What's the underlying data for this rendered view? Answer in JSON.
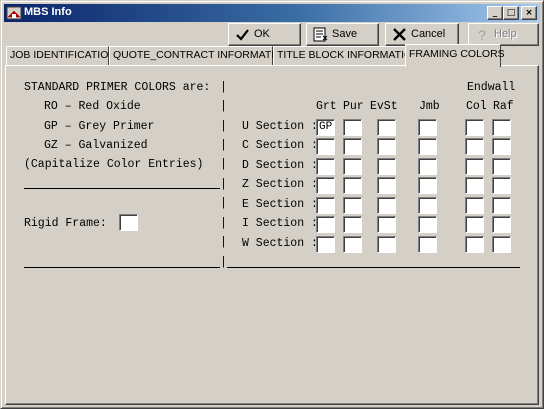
{
  "window": {
    "title": "MBS Info"
  },
  "titlebar_buttons": {
    "minimize": "_",
    "maximize": "□",
    "close": "×"
  },
  "toolbar": {
    "ok_label": "OK",
    "save_label": "Save",
    "cancel_label": "Cancel",
    "help_label": "Help"
  },
  "tabs": [
    {
      "label": "JOB IDENTIFICATION"
    },
    {
      "label": "QUOTE_CONTRACT INFORMATION"
    },
    {
      "label": "TITLE BLOCK INFORMATION"
    },
    {
      "label": "FRAMING COLORS"
    }
  ],
  "active_tab": "FRAMING COLORS",
  "left": {
    "heading": "STANDARD PRIMER COLORS are:",
    "codes": [
      {
        "code": "RO",
        "name": "Red Oxide"
      },
      {
        "code": "GP",
        "name": "Grey Primer"
      },
      {
        "code": "GZ",
        "name": "Galvanized"
      }
    ],
    "note": "(Capitalize Color Entries)",
    "rigid_frame_label": "Rigid Frame:",
    "rigid_frame_value": ""
  },
  "grid": {
    "group_header": "Endwall",
    "columns": [
      "Grt",
      "Pur",
      "EvSt",
      "Jmb",
      "Col",
      "Raf"
    ],
    "rows": [
      {
        "label": "U Section :",
        "values": [
          "GP",
          "",
          "",
          "",
          "",
          ""
        ]
      },
      {
        "label": "C Section :",
        "values": [
          "",
          "",
          "",
          "",
          "",
          ""
        ]
      },
      {
        "label": "D Section :",
        "values": [
          "",
          "",
          "",
          "",
          "",
          ""
        ]
      },
      {
        "label": "Z Section :",
        "values": [
          "",
          "",
          "",
          "",
          "",
          ""
        ]
      },
      {
        "label": "E Section :",
        "values": [
          "",
          "",
          "",
          "",
          "",
          ""
        ]
      },
      {
        "label": "I Section :",
        "values": [
          "",
          "",
          "",
          "",
          "",
          ""
        ]
      },
      {
        "label": "W Section :",
        "values": [
          "",
          "",
          "",
          "",
          "",
          ""
        ]
      }
    ]
  },
  "divider_char": "|"
}
